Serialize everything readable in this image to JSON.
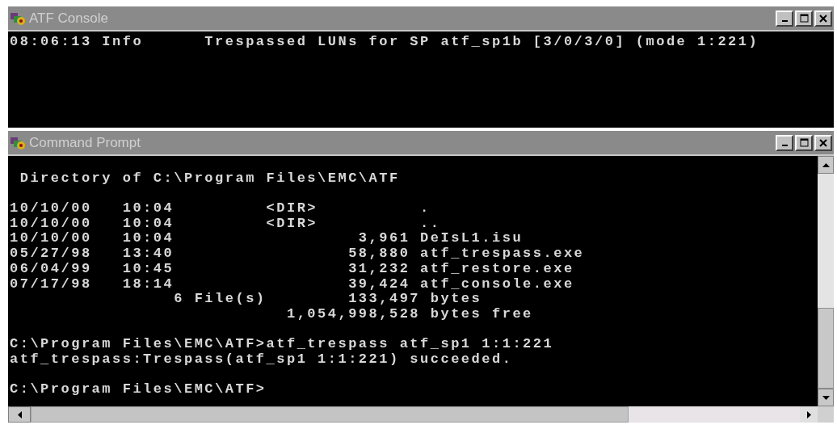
{
  "windows": [
    {
      "title": "ATF Console",
      "kind": "console",
      "blocks": [
        [
          "08:06:13 Info      Trespassed LUNs for SP atf_sp1b [3/0/3/0] (mode 1:221)"
        ]
      ]
    },
    {
      "title": "Command Prompt",
      "kind": "cmd",
      "blocks": [
        [
          " Directory of C:\\Program Files\\EMC\\ATF"
        ],
        [
          "10/10/00   10:04         <DIR>          .",
          "10/10/00   10:04         <DIR>          ..",
          "10/10/00   10:04                  3,961 DeIsL1.isu",
          "05/27/98   13:40                 58,880 atf_trespass.exe",
          "06/04/99   10:45                 31,232 atf_restore.exe",
          "07/17/98   18:14                 39,424 atf_console.exe",
          "                6 File(s)        133,497 bytes",
          "                           1,054,998,528 bytes free"
        ],
        [
          "C:\\Program Files\\EMC\\ATF>atf_trespass atf_sp1 1:1:221",
          "atf_trespass:Trespass(atf_sp1 1:1:221) succeeded."
        ],
        [
          "C:\\Program Files\\EMC\\ATF>"
        ]
      ]
    }
  ]
}
